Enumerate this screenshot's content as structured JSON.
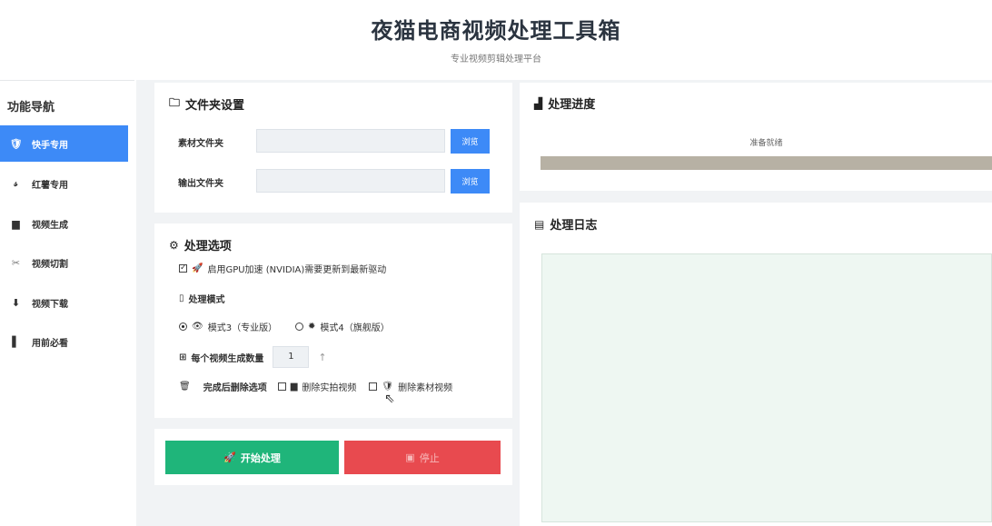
{
  "header": {
    "title": "夜猫电商视频处理工具箱",
    "subtitle": "专业视频剪辑处理平台"
  },
  "sidebar": {
    "title": "功能导航",
    "items": [
      {
        "icon": "🛡",
        "label": "快手专用",
        "active": true
      },
      {
        "icon": "𝓈",
        "label": "红薯专用",
        "active": false
      },
      {
        "icon": "▆",
        "label": "视频生成",
        "active": false
      },
      {
        "icon": "✂",
        "label": "视频切割",
        "active": false
      },
      {
        "icon": "⬇",
        "label": "视频下载",
        "active": false
      },
      {
        "icon": "▌",
        "label": "用前必看",
        "active": false
      }
    ]
  },
  "folders": {
    "icon": "🗀",
    "title": "文件夹设置",
    "source_label": "素材文件夹",
    "source_value": "",
    "output_label": "输出文件夹",
    "output_value": "",
    "browse_label": "浏览"
  },
  "options": {
    "icon": "⚙",
    "title": "处理选项",
    "gpu_icon": "🚀",
    "gpu_label": "启用GPU加速 (NVIDIA)需要更新到最新驱动",
    "gpu_checked": true,
    "mode_icon": "▯",
    "mode_title": "处理模式",
    "mode3_icon": "👁",
    "mode3_label": "模式3（专业版）",
    "mode3_selected": true,
    "mode4_icon": "✹",
    "mode4_label": "模式4（旗舰版）",
    "mode4_selected": false,
    "count_icon": "⊞",
    "count_label": "每个视频生成数量",
    "count_value": "1",
    "delete_icon": "🗑",
    "delete_title": "完成后删除选项",
    "delete_shot_icon": "▆",
    "delete_shot_label": "删除实拍视频",
    "delete_shot_checked": false,
    "delete_material_icon": "🛡",
    "delete_material_label": "删除素材视频",
    "delete_material_checked": false
  },
  "actions": {
    "start_icon": "🚀",
    "start_label": "开始处理",
    "stop_icon": "▣",
    "stop_label": "停止"
  },
  "progress": {
    "icon": "▟",
    "title": "处理进度",
    "status": "准备就绪",
    "value": 1.0
  },
  "log": {
    "icon": "▤",
    "title": "处理日志",
    "content": ""
  },
  "colors": {
    "accent": "#3d8af7",
    "start": "#1fb57a",
    "stop": "#e84a4f",
    "progress_fill": "#b7b1a4"
  }
}
